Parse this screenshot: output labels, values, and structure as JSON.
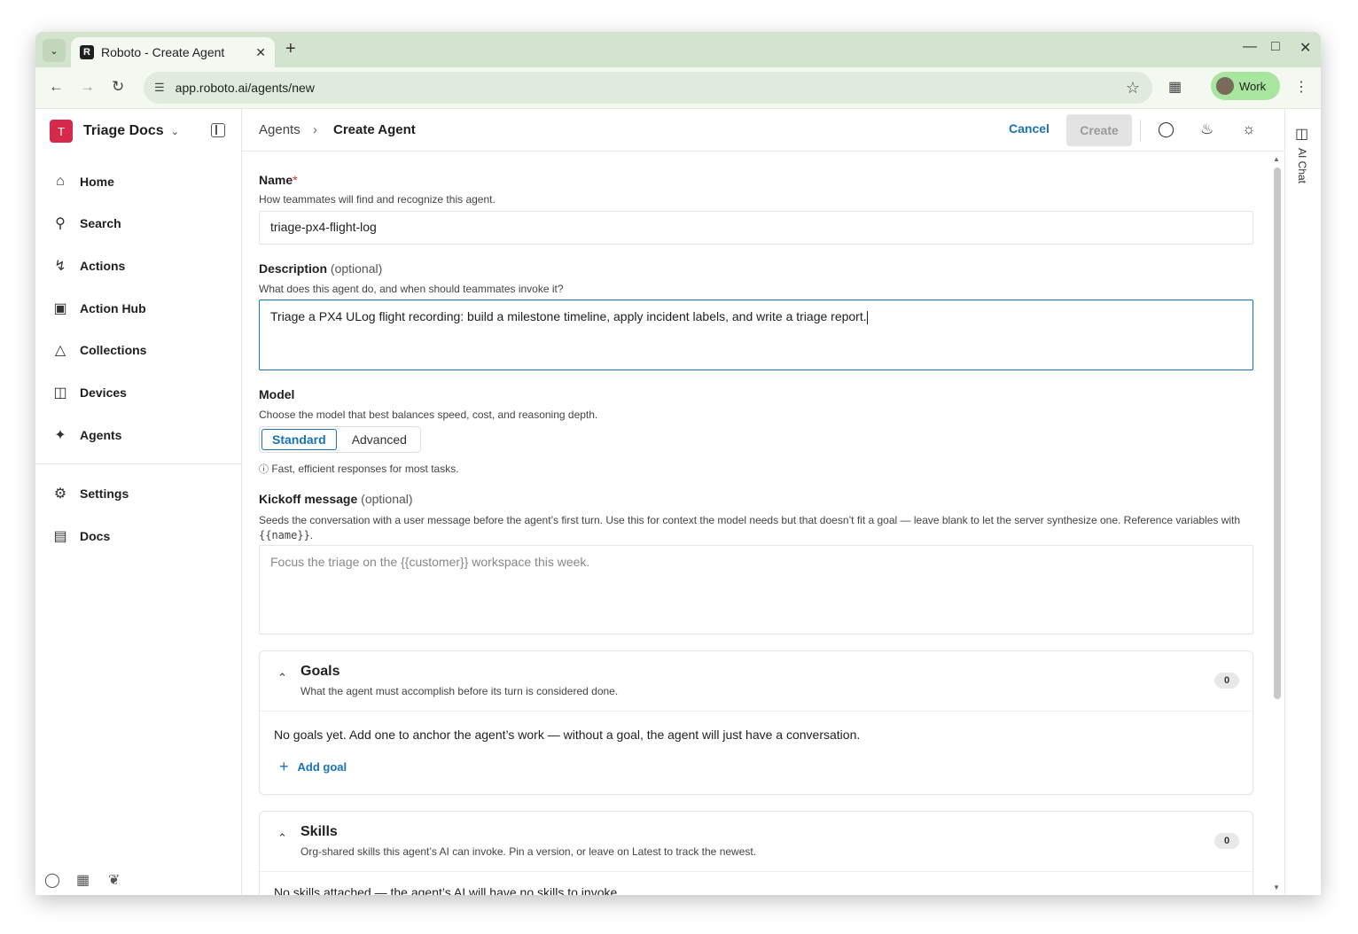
{
  "browser": {
    "tab_title": "Roboto - Create Agent",
    "url": "app.roboto.ai/agents/new",
    "profile_label": "Work"
  },
  "workspace": {
    "initial": "T",
    "name": "Triage Docs"
  },
  "sidebar": {
    "items": [
      {
        "label": "Home",
        "icon": "home-icon"
      },
      {
        "label": "Search",
        "icon": "search-icon"
      },
      {
        "label": "Actions",
        "icon": "bolt-icon"
      },
      {
        "label": "Action Hub",
        "icon": "store-icon"
      },
      {
        "label": "Collections",
        "icon": "shapes-icon"
      },
      {
        "label": "Devices",
        "icon": "robot-icon"
      },
      {
        "label": "Agents",
        "icon": "sparkles-icon"
      }
    ],
    "bottom_items": [
      {
        "label": "Settings",
        "icon": "gear-icon"
      },
      {
        "label": "Docs",
        "icon": "document-icon"
      }
    ]
  },
  "header": {
    "breadcrumb_root": "Agents",
    "breadcrumb_current": "Create Agent",
    "cancel_label": "Cancel",
    "create_label": "Create"
  },
  "ai_chat": {
    "label": "AI Chat"
  },
  "form": {
    "name": {
      "label": "Name",
      "required_mark": "*",
      "help": "How teammates will find and recognize this agent.",
      "value": "triage-px4-flight-log"
    },
    "description": {
      "label": "Description",
      "optional": "(optional)",
      "help": "What does this agent do, and when should teammates invoke it?",
      "value": "Triage a PX4 ULog flight recording: build a milestone timeline, apply incident labels, and write a triage report."
    },
    "model": {
      "label": "Model",
      "help": "Choose the model that best balances speed, cost, and reasoning depth.",
      "options": [
        "Standard",
        "Advanced"
      ],
      "selected": "Standard",
      "note": "Fast, efficient responses for most tasks."
    },
    "kickoff": {
      "label": "Kickoff message",
      "optional": "(optional)",
      "help": "Seeds the conversation with a user message before the agent’s first turn. Use this for context the model needs but that doesn’t fit a goal — leave blank to let the server synthesize one. Reference variables with",
      "help_code": "{{name}}",
      "help_end": ".",
      "placeholder": "Focus the triage on the {{customer}} workspace this week."
    }
  },
  "goals": {
    "title": "Goals",
    "subtitle": "What the agent must accomplish before its turn is considered done.",
    "count": "0",
    "empty_text": "No goals yet. Add one to anchor the agent’s work — without a goal, the agent will just have a conversation.",
    "add_label": "Add goal"
  },
  "skills": {
    "title": "Skills",
    "subtitle": "Org-shared skills this agent’s AI can invoke. Pin a version, or leave on Latest to track the newest.",
    "count": "0",
    "empty_text": "No skills attached — the agent’s AI will have no skills to invoke."
  }
}
